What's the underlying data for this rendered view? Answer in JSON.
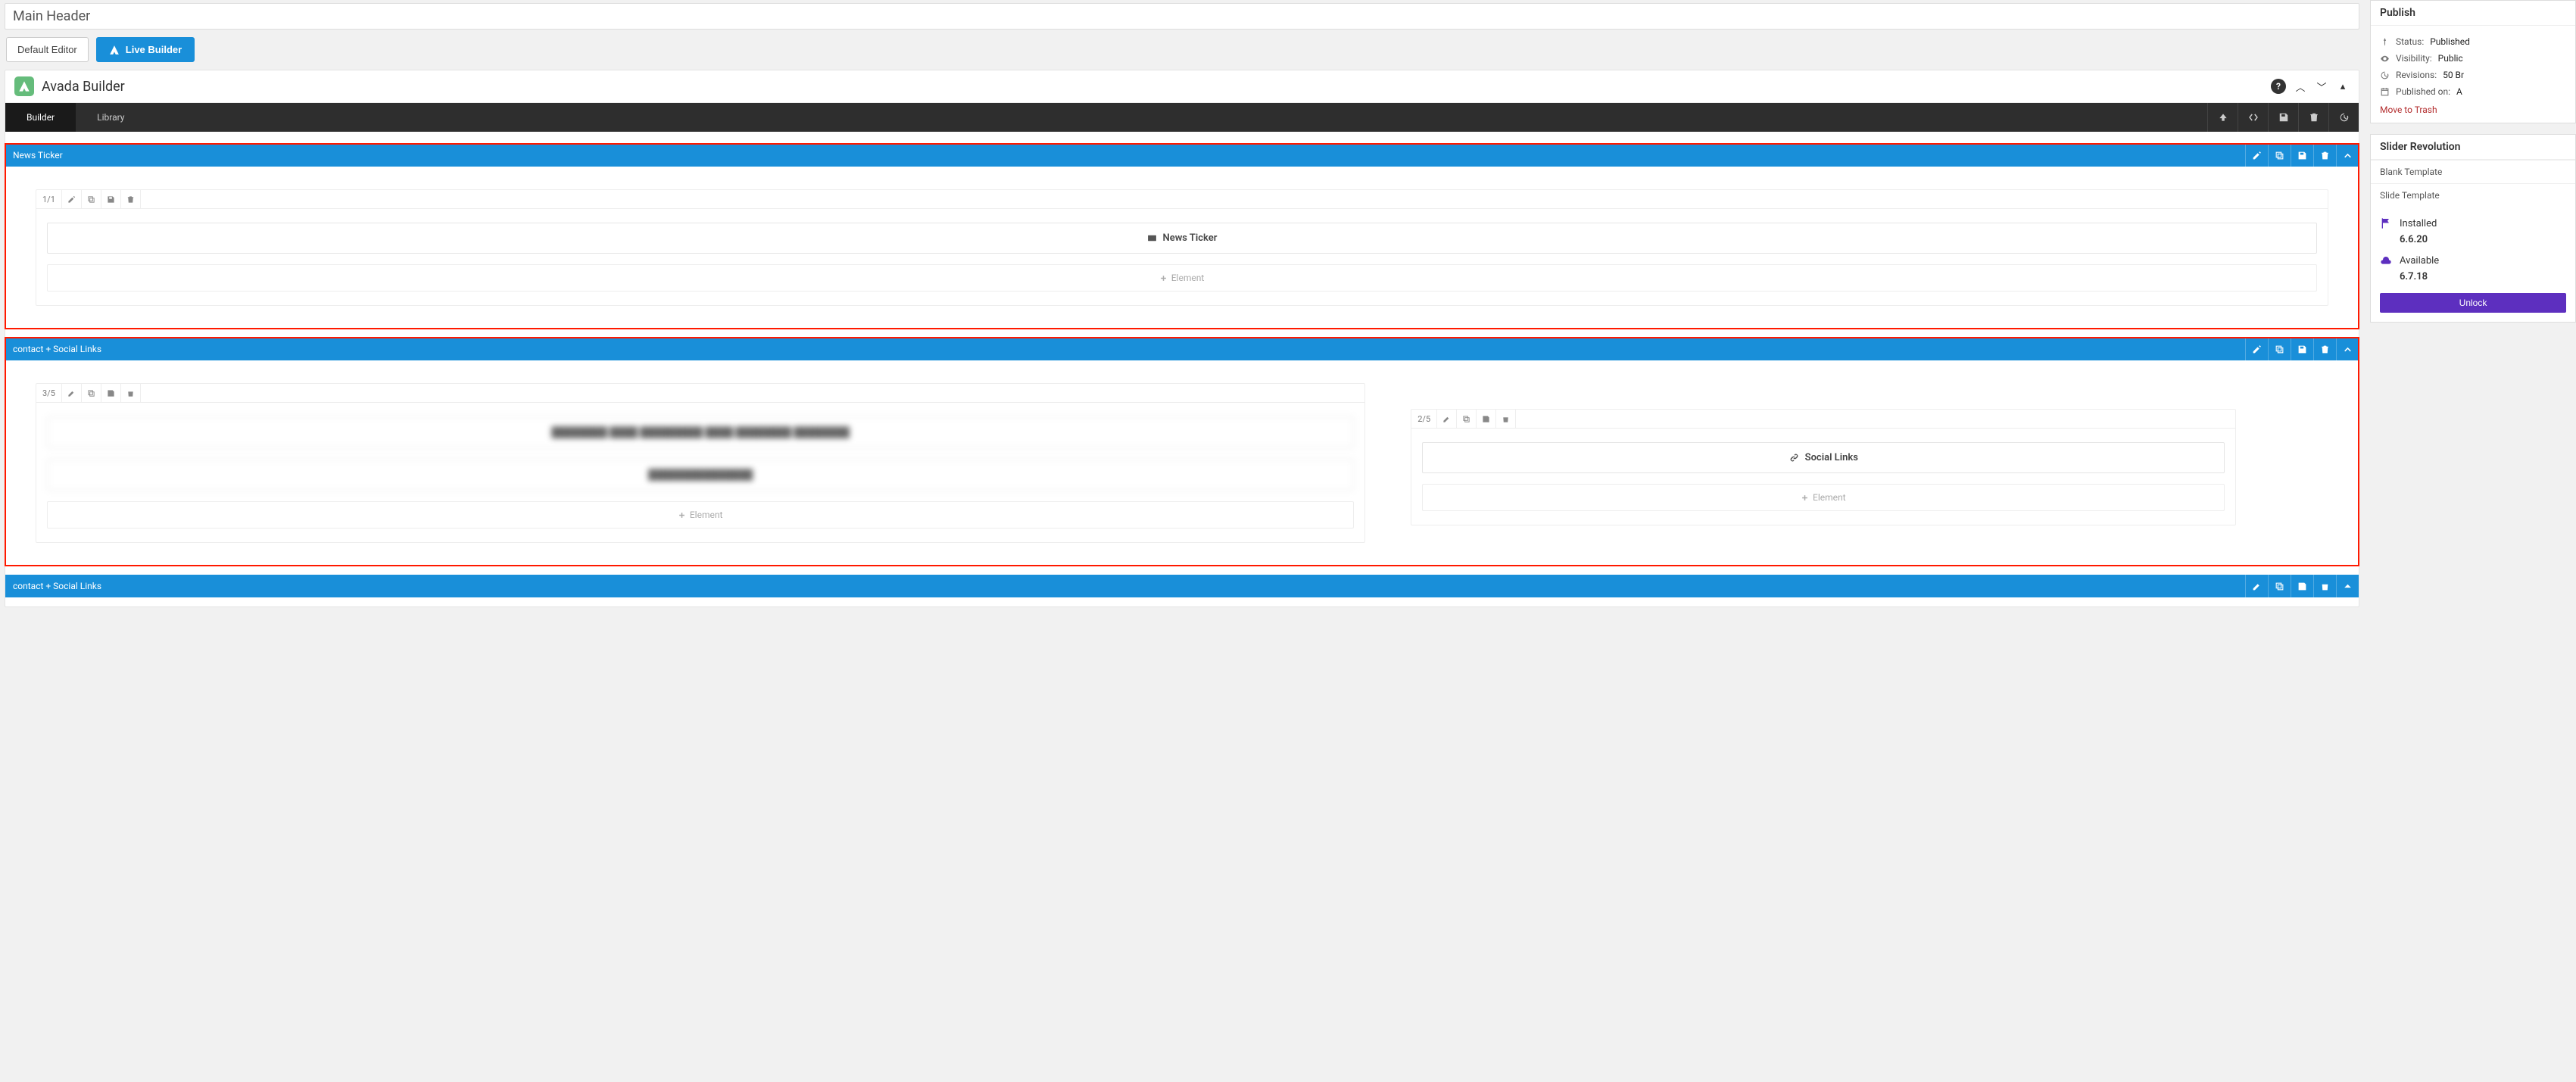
{
  "title_bar": "Main Header",
  "toolbar": {
    "default_editor": "Default Editor",
    "live_builder": "Live Builder"
  },
  "builder": {
    "title": "Avada Builder",
    "help_icon": "help-icon",
    "tabs": {
      "builder": "Builder",
      "library": "Library"
    }
  },
  "containers": [
    {
      "label": "News Ticker",
      "outlined": true,
      "columns": [
        {
          "fraction": "1/1",
          "elements": [
            {
              "kind": "labeled",
              "icon": "news-icon",
              "text": "News Ticker"
            }
          ],
          "add_label": "Element"
        }
      ]
    },
    {
      "label": "contact + Social Links",
      "outlined": true,
      "columns": [
        {
          "fraction": "3/5",
          "width": "58%",
          "elements": [
            {
              "kind": "blur",
              "text": "████████ ████ █████████ ████ ████████ ████████"
            },
            {
              "kind": "blur",
              "text": "███████████████"
            }
          ],
          "add_label": "Element"
        },
        {
          "fraction": "2/5",
          "width": "36%",
          "pad_top": true,
          "elements": [
            {
              "kind": "labeled",
              "icon": "link-icon",
              "text": "Social Links"
            }
          ],
          "add_label": "Element"
        }
      ]
    },
    {
      "label": "contact + Social Links",
      "bar_only": true
    }
  ],
  "sidebar": {
    "publish": {
      "title": "Publish",
      "status_label": "Status:",
      "status_value": "Published",
      "visibility_label": "Visibility:",
      "visibility_value": "Public",
      "revisions_label": "Revisions:",
      "revisions_value": "50 Br",
      "published_label": "Published on:",
      "published_value": "A",
      "trash": "Move to Trash"
    },
    "slider": {
      "title": "Slider Revolution",
      "blank": "Blank Template",
      "slide": "Slide Template",
      "installed_label": "Installed",
      "installed_ver": "6.6.20",
      "available_label": "Available",
      "available_ver": "6.7.18",
      "unlock": "Unlock"
    }
  }
}
